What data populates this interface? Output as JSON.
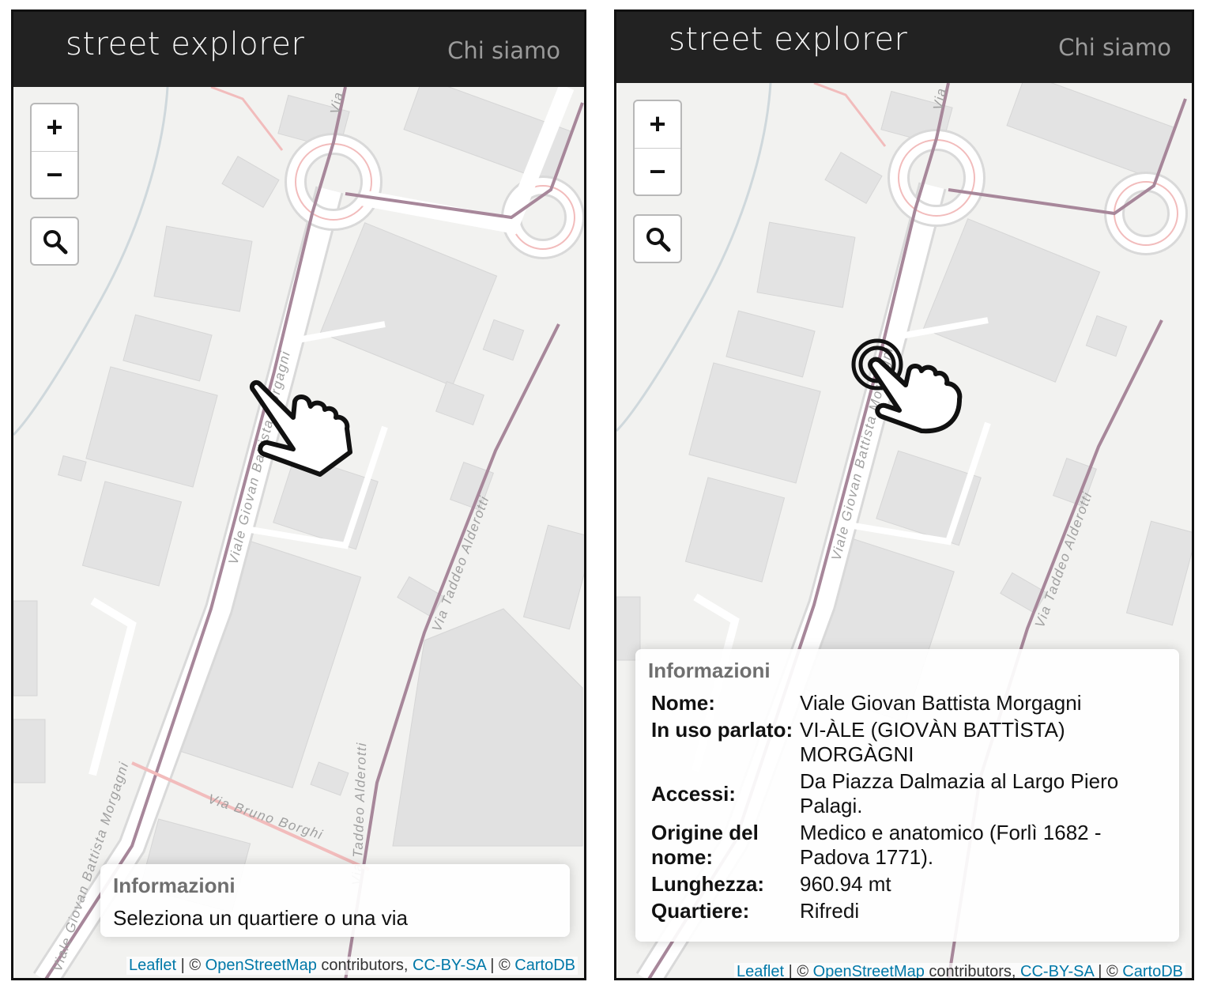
{
  "left_screen": {
    "header": {
      "brand": "street explorer",
      "nav_link": "Chi siamo"
    },
    "zoom": {
      "in_label": "+",
      "out_label": "−"
    },
    "search_button_icon": "search-icon",
    "info_panel": {
      "title": "Informazioni",
      "message": "Seleziona un quartiere o una via"
    },
    "gesture_icon": "pointing-hand-icon",
    "street_labels": {
      "morgagni_top": "Viale Giovan Battista Morgagni",
      "alderotti": "Via Taddeo Alderotti",
      "alderotti_lower": "Via Taddeo Alderotti",
      "borghi": "Via Bruno Borghi",
      "morgagni_bottom": "Viale Giovan Battista Morgagni",
      "via_top": "Via"
    },
    "attribution": {
      "leaflet": "Leaflet",
      "sep1": " | © ",
      "osm": "OpenStreetMap",
      "contributors": " contributors, ",
      "license": "CC-BY-SA",
      "sep2": " | © ",
      "cartodb": "CartoDB"
    }
  },
  "right_screen": {
    "header": {
      "brand": "street explorer",
      "nav_link": "Chi siamo"
    },
    "zoom": {
      "in_label": "+",
      "out_label": "−"
    },
    "search_button_icon": "search-icon",
    "gesture_icon": "tapping-hand-icon",
    "street_labels": {
      "morgagni_top": "Viale Giovan Battista Morgagni",
      "alderotti": "Via Taddeo Alderotti",
      "via_top": "Via"
    },
    "info_panel": {
      "title": "Informazioni",
      "rows": [
        {
          "key": "Nome:",
          "value": "Viale Giovan Battista Morgagni"
        },
        {
          "key": "In uso parlato:",
          "value": "VI-ÀLE (GIOVÀN BATTÌSTA) MORGÀGNI"
        },
        {
          "key": "Accessi:",
          "value": "Da Piazza Dalmazia al Largo Piero Palagi."
        },
        {
          "key": "Origine del nome:",
          "value": "Medico e anatomico (Forlì 1682 - Padova 1771)."
        },
        {
          "key": "Lunghezza:",
          "value": "960.94 mt"
        },
        {
          "key": "Quartiere:",
          "value": "Rifredi"
        }
      ]
    },
    "attribution": {
      "leaflet": "Leaflet",
      "sep1": " | © ",
      "osm": "OpenStreetMap",
      "contributors": " contributors, ",
      "license": "CC-BY-SA",
      "sep2": " | © ",
      "cartodb": "CartoDB"
    }
  },
  "colors": {
    "topbar": "#222222",
    "map_background": "#f2f2f0",
    "building": "#e3e3e3",
    "road_casing": "#d9d9d9",
    "street_highlight": "#a7879a",
    "roundabout_red": "#f2bcbc",
    "link": "#0078a8"
  }
}
